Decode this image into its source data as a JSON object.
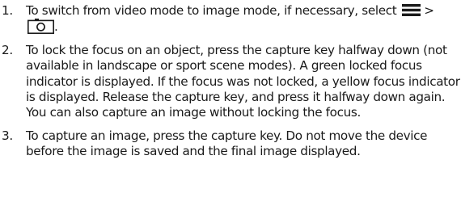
{
  "steps": [
    {
      "number": "1.",
      "text_before": "To switch from video mode to image mode, if necessary, select",
      "separator": ">",
      "text_after": ".",
      "icons": [
        "menu-icon",
        "camera-icon"
      ]
    },
    {
      "number": "2.",
      "text": "To lock the focus on an object, press the capture key halfway down (not available in landscape or sport scene modes). A green locked focus indicator is displayed. If the focus was not locked, a yellow focus indicator is displayed. Release the capture key, and press it halfway down again. You can also capture an image without locking the focus."
    },
    {
      "number": "3.",
      "text": "To capture an image, press the capture key. Do not move the device before the image is saved and the final image displayed."
    }
  ]
}
